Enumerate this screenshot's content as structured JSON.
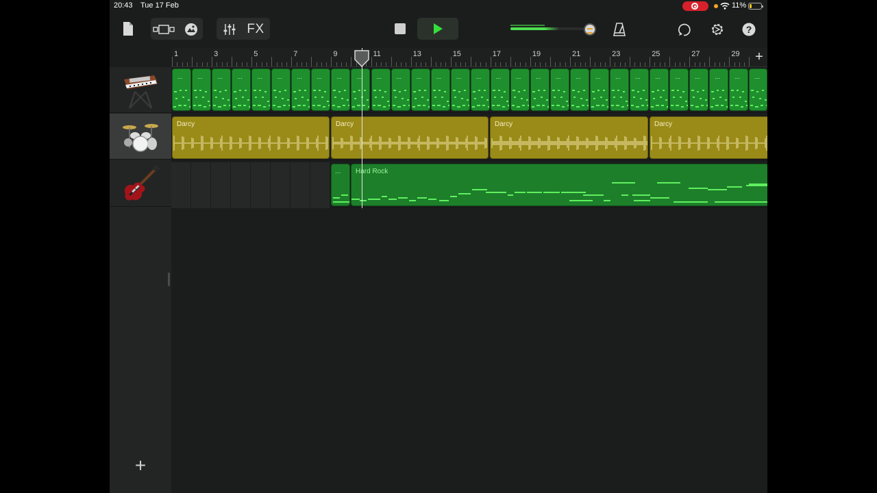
{
  "status_bar": {
    "time": "20:43",
    "date": "Tue 17 Feb",
    "battery": "11%"
  },
  "toolbar": {
    "fx_label": "FX",
    "icons": [
      "my-songs-icon",
      "view-toggle-icon",
      "browser-icon",
      "mixer-icon",
      "fx-icon",
      "stop-icon",
      "play-icon",
      "master-volume-icon",
      "metronome-icon",
      "loop-browser-icon",
      "settings-icon",
      "help-icon"
    ]
  },
  "ruler": {
    "numbers": [
      "1",
      "3",
      "5",
      "7",
      "9",
      "11",
      "13",
      "15",
      "17",
      "19",
      "21",
      "23",
      "25",
      "27",
      "29"
    ]
  },
  "tracks": [
    {
      "name": "keyboard-track",
      "instrument_icon": "synthesizer-icon"
    },
    {
      "name": "drums-track",
      "instrument_icon": "drum-kit-icon"
    },
    {
      "name": "guitar-track",
      "instrument_icon": "electric-guitar-icon"
    }
  ],
  "regions": {
    "drums": [
      {
        "label": "Darcy"
      },
      {
        "label": "Darcy"
      },
      {
        "label": "Darcy"
      },
      {
        "label": "Darcy"
      }
    ],
    "guitar": [
      {
        "label": "..."
      },
      {
        "label": "Hard Rock"
      }
    ],
    "keys_loop_label": "...",
    "keys_loop_count": 30
  },
  "colors": {
    "midi_green": "#1f8f2e",
    "note_green": "#5ff05f",
    "audio_gold": "#9a8b18",
    "accent_green": "#4fe04f"
  }
}
